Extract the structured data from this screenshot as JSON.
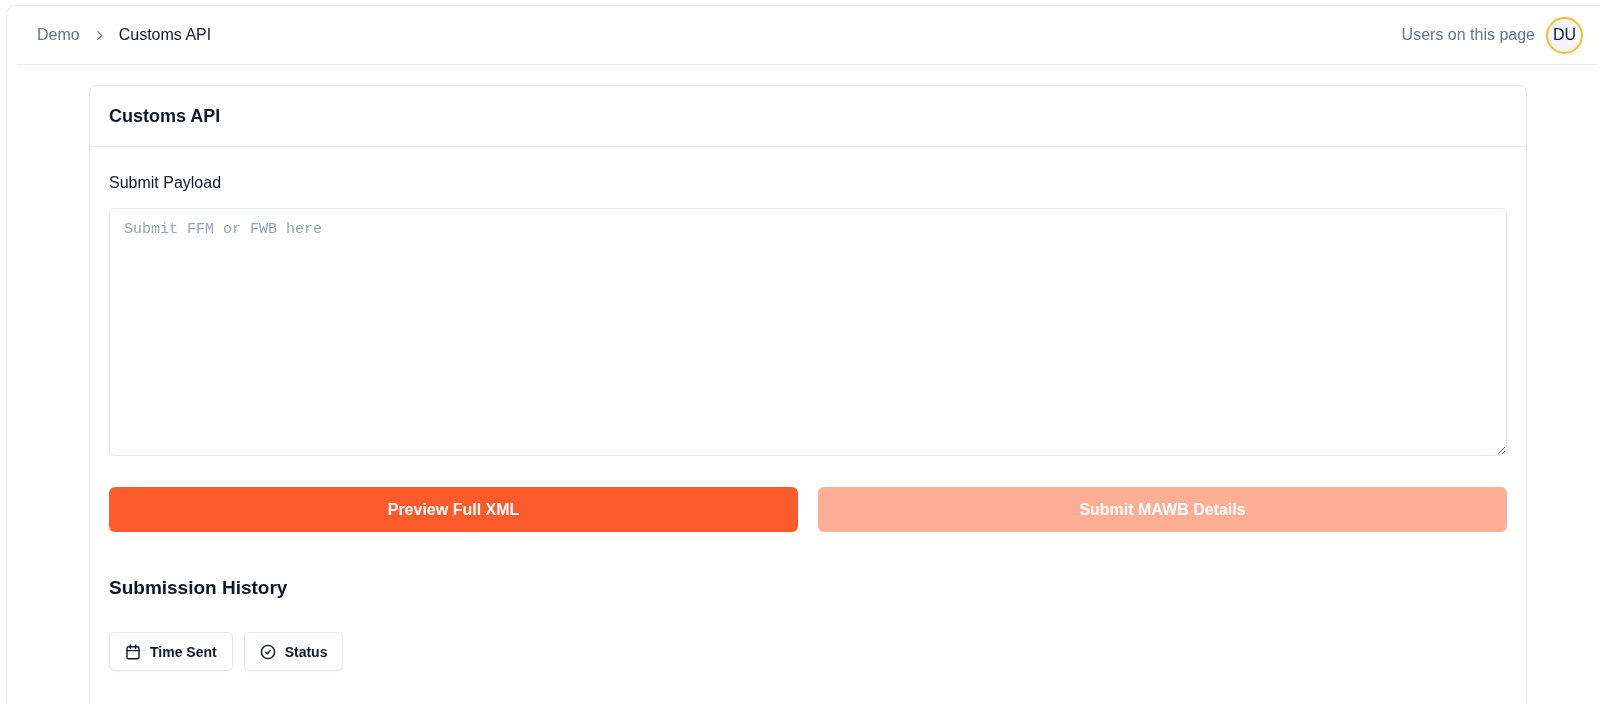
{
  "breadcrumb": [
    {
      "label": "Demo",
      "current": false
    },
    {
      "label": "Customs API",
      "current": true
    }
  ],
  "presence": {
    "label": "Users on this page",
    "users": [
      {
        "initials": "DU",
        "color": "#fbbf24"
      }
    ]
  },
  "card": {
    "title": "Customs API",
    "payload": {
      "label": "Submit Payload",
      "placeholder": "Submit FFM or FWB here"
    },
    "actions": [
      {
        "label": "Preview Full XML",
        "disabled": false
      },
      {
        "label": "Submit MAWB Details",
        "disabled": true
      }
    ],
    "history": {
      "title": "Submission History",
      "filters": [
        {
          "label": "Time Sent",
          "kind": "date"
        },
        {
          "label": "Status",
          "kind": "status"
        }
      ]
    }
  }
}
